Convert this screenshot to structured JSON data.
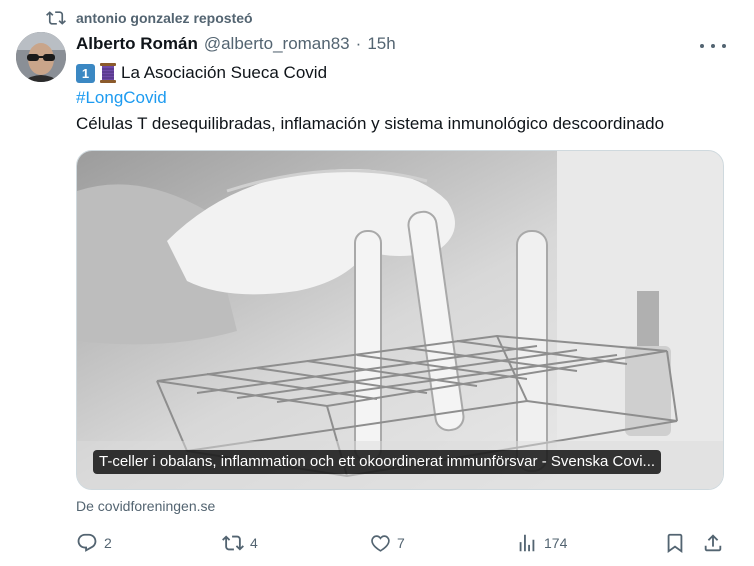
{
  "repost": {
    "text": "antonio gonzalez reposteó",
    "icon": "repost-icon"
  },
  "author": {
    "name": "Alberto Román",
    "handle": "@alberto_roman83",
    "separator": "·",
    "time": "15h"
  },
  "tweet": {
    "line1_emoji": [
      "keycap-1",
      "spool-of-thread"
    ],
    "keycap_text": "1",
    "line1_text": "La Asociación Sueca Covid",
    "hashtag": "#LongCovid",
    "body": "Células T desequilibradas, inflamación y sistema inmunológico descoordinado"
  },
  "card": {
    "caption": "T-celler i obalans, inflammation och ett okoordinerat immunförsvar - Svenska Covi...",
    "source": "De covidforeningen.se"
  },
  "actions": {
    "replies": "2",
    "reposts": "4",
    "likes": "7",
    "views": "174"
  },
  "colors": {
    "accent": "#1d9bf0",
    "muted": "#536471",
    "text": "#0f1419",
    "border": "#cfd9de"
  }
}
